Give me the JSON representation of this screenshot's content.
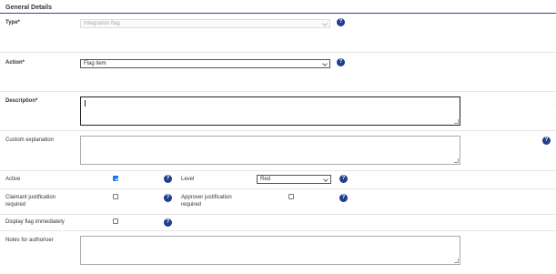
{
  "section": {
    "title": "General Details"
  },
  "type": {
    "label": "Type*",
    "value": "Integration flag"
  },
  "action": {
    "label": "Action*",
    "value": "Flag item"
  },
  "description": {
    "label": "Description*",
    "value": ""
  },
  "custom_explanation": {
    "label": "Custom explanation",
    "value": ""
  },
  "active": {
    "label": "Active",
    "checked": true
  },
  "level": {
    "label": "Level",
    "value": "Red"
  },
  "claimant_justification": {
    "label_line1": "Claimant justification",
    "label_line2": "required",
    "checked": false
  },
  "approver_justification": {
    "label_line1": "Approver justification",
    "label_line2": "required",
    "checked": false
  },
  "display_flag": {
    "label": "Display flag immediately",
    "checked": false
  },
  "notes": {
    "label": "Notes for authoriser",
    "value": ""
  },
  "help_glyph": "?",
  "icons": {
    "help": "help-circle-icon",
    "dropdown": "chevron-down-icon",
    "check": "checkmark-icon"
  },
  "colors": {
    "accent": "#1f3f8c",
    "rule": "#2a4a87",
    "checkbox_on": "#1a73e8"
  }
}
